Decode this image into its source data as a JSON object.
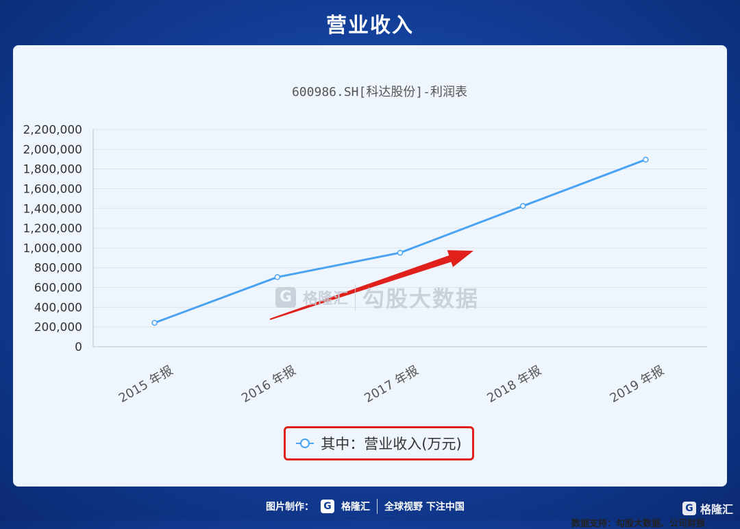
{
  "header": {
    "title": "营业收入"
  },
  "chart_data": {
    "type": "line",
    "title": "600986.SH[科达股份]-利润表",
    "categories": [
      "2015 年报",
      "2016 年报",
      "2017 年报",
      "2018 年报",
      "2019 年报"
    ],
    "series": [
      {
        "name": "其中：营业收入(万元)",
        "values": [
          242000,
          705000,
          952000,
          1425000,
          1895000
        ],
        "color": "#4aa3f2"
      }
    ],
    "ylim": [
      0,
      2200000
    ],
    "yticks": [
      0,
      200000,
      400000,
      600000,
      800000,
      1000000,
      1200000,
      1400000,
      1600000,
      1800000,
      2000000,
      2200000
    ],
    "ytick_labels": [
      "0",
      "200,000",
      "400,000",
      "600,000",
      "800,000",
      "1,000,000",
      "1,200,000",
      "1,400,000",
      "1,600,000",
      "1,800,000",
      "2,000,000",
      "2,200,000"
    ],
    "grid": true,
    "legend_position": "bottom-center",
    "annotation": {
      "type": "arrow",
      "color": "#e0201b"
    }
  },
  "legend": {
    "label": "其中：营业收入(万元)"
  },
  "watermark": {
    "logo_letter": "G",
    "brand": "格隆汇",
    "text": "勾股大数据"
  },
  "source_note": "数据支持：勾股大数据、公司财报",
  "footer": {
    "credit_label": "图片制作：",
    "logo_letter": "G",
    "brand": "格隆汇",
    "slogan": "全球视野 下注中国"
  },
  "corner_logo": {
    "logo_letter": "G",
    "brand": "格隆汇"
  }
}
